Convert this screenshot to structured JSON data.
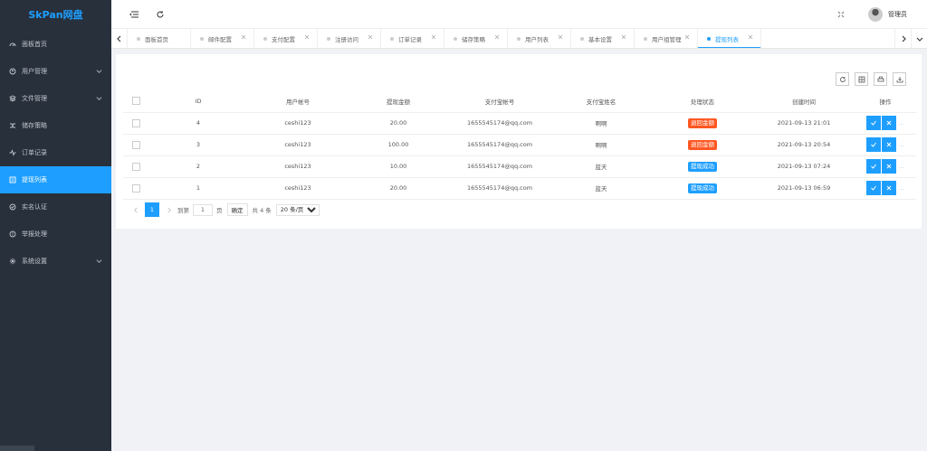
{
  "app": {
    "logo": "SkPan网盘"
  },
  "sidebar": {
    "items": [
      {
        "label": "面板首页",
        "icon": "dashboard-icon",
        "arrow": false,
        "active": false
      },
      {
        "label": "用户管理",
        "icon": "user-icon",
        "arrow": true,
        "active": false
      },
      {
        "label": "文件管理",
        "icon": "layers-icon",
        "arrow": true,
        "active": false
      },
      {
        "label": "储存策略",
        "icon": "strategy-icon",
        "arrow": false,
        "active": false
      },
      {
        "label": "订单记录",
        "icon": "activity-icon",
        "arrow": false,
        "active": false
      },
      {
        "label": "提现列表",
        "icon": "list-icon",
        "arrow": false,
        "active": true
      },
      {
        "label": "实名认证",
        "icon": "verify-icon",
        "arrow": false,
        "active": false
      },
      {
        "label": "举报处理",
        "icon": "report-icon",
        "arrow": false,
        "active": false
      },
      {
        "label": "系统设置",
        "icon": "settings-icon",
        "arrow": true,
        "active": false
      }
    ]
  },
  "header": {
    "username": "管理员"
  },
  "tabs": [
    {
      "label": "面板首页",
      "active": false,
      "closable": false
    },
    {
      "label": "邮件配置",
      "active": false,
      "closable": true
    },
    {
      "label": "支付配置",
      "active": false,
      "closable": true
    },
    {
      "label": "注册访问",
      "active": false,
      "closable": true
    },
    {
      "label": "订单记录",
      "active": false,
      "closable": true
    },
    {
      "label": "储存策略",
      "active": false,
      "closable": true
    },
    {
      "label": "用户列表",
      "active": false,
      "closable": true
    },
    {
      "label": "基本设置",
      "active": false,
      "closable": true
    },
    {
      "label": "用户组管理",
      "active": false,
      "closable": true
    },
    {
      "label": "提现列表",
      "active": true,
      "closable": true
    }
  ],
  "table": {
    "columns": {
      "id": "ID",
      "account": "用户帐号",
      "amount": "提现金额",
      "alipay": "支付宝帐号",
      "name": "支付宝姓名",
      "status": "处理状态",
      "created": "创建时间",
      "ops": "操作"
    },
    "rows": [
      {
        "id": "4",
        "account": "ceshi123",
        "amount": "20.00",
        "alipay": "1655545174@qq.com",
        "name": "啊啊",
        "status": "退回金额",
        "status_color": "#ff5722",
        "created": "2021-09-13 21:01"
      },
      {
        "id": "3",
        "account": "ceshi123",
        "amount": "100.00",
        "alipay": "1655545174@qq.com",
        "name": "啊啊",
        "status": "退回金额",
        "status_color": "#ff5722",
        "created": "2021-09-13 20:54"
      },
      {
        "id": "2",
        "account": "ceshi123",
        "amount": "10.00",
        "alipay": "1655545174@qq.com",
        "name": "蓝天",
        "status": "提现成功",
        "status_color": "#1e9fff",
        "created": "2021-09-13 07:24"
      },
      {
        "id": "1",
        "account": "ceshi123",
        "amount": "20.00",
        "alipay": "1655545174@qq.com",
        "name": "蓝天",
        "status": "提现成功",
        "status_color": "#1e9fff",
        "created": "2021-09-13 06:59"
      }
    ]
  },
  "pager": {
    "current": "1",
    "goto_label": "到第",
    "goto_value": "1",
    "page_unit": "页",
    "confirm": "确定",
    "total": "共 4 条",
    "page_size": "20 条/页"
  },
  "colors": {
    "accent": "#1e9fff",
    "sidebar_bg": "#28303c",
    "danger": "#ff5722"
  }
}
